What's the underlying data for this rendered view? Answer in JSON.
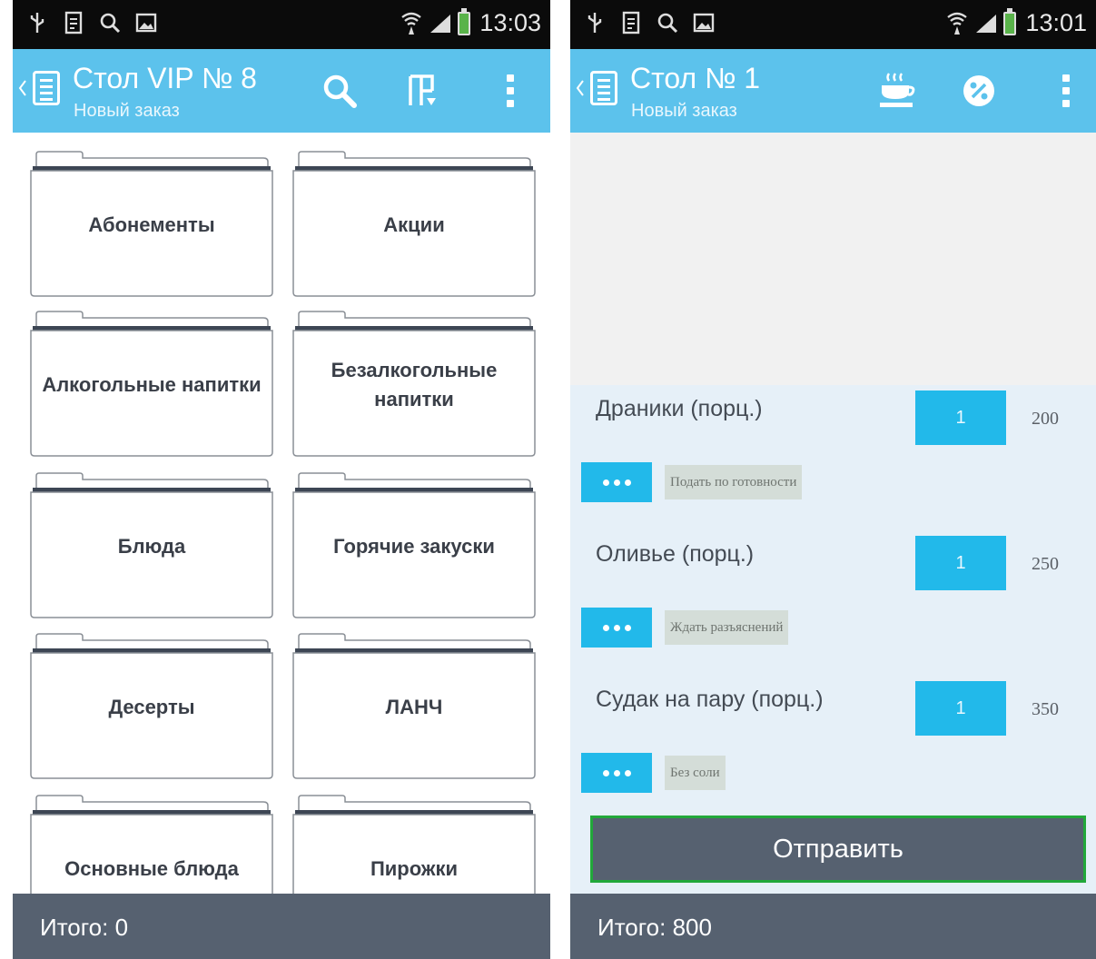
{
  "left": {
    "status": {
      "time": "13:03"
    },
    "appbar": {
      "title": "Стол VIP № 8",
      "subtitle": "Новый заказ"
    },
    "categories": [
      {
        "label": "Абонементы"
      },
      {
        "label": "Акции"
      },
      {
        "label": "Алкогольные напитки"
      },
      {
        "label": "Безалкогольные напитки"
      },
      {
        "label": "Блюда"
      },
      {
        "label": "Горячие закуски"
      },
      {
        "label": "Десерты"
      },
      {
        "label": "ЛАНЧ"
      },
      {
        "label": "Основные блюда"
      },
      {
        "label": "Пирожки"
      }
    ],
    "footer": {
      "total": "Итого: 0"
    }
  },
  "right": {
    "status": {
      "time": "13:01"
    },
    "appbar": {
      "title": "Стол № 1",
      "subtitle": "Новый заказ"
    },
    "items": [
      {
        "name": "Драники (порц.)",
        "qty": "1",
        "price": "200",
        "note": "Подать по готовности"
      },
      {
        "name": "Оливье (порц.)",
        "qty": "1",
        "price": "250",
        "note": "Ждать разъяснений"
      },
      {
        "name": "Судак на пару (порц.)",
        "qty": "1",
        "price": "350",
        "note": "Без соли"
      }
    ],
    "send_label": "Отправить",
    "footer": {
      "total": "Итого: 800"
    }
  },
  "colors": {
    "appbar": "#5cc2ec",
    "status_bar": "#0b0b0b",
    "footer": "#566170",
    "accent_button": "#22b9ea",
    "send_border": "#22a83a"
  },
  "icons": {
    "status_left": [
      "usb-icon",
      "file-icon",
      "search-icon",
      "image-icon"
    ],
    "status_right": [
      "wifi-icon",
      "signal-icon",
      "battery-icon"
    ],
    "left_actions": [
      "search-icon",
      "layout-icon",
      "overflow-menu-icon"
    ],
    "right_actions": [
      "hot-dish-icon",
      "discount-icon",
      "overflow-menu-icon"
    ]
  }
}
